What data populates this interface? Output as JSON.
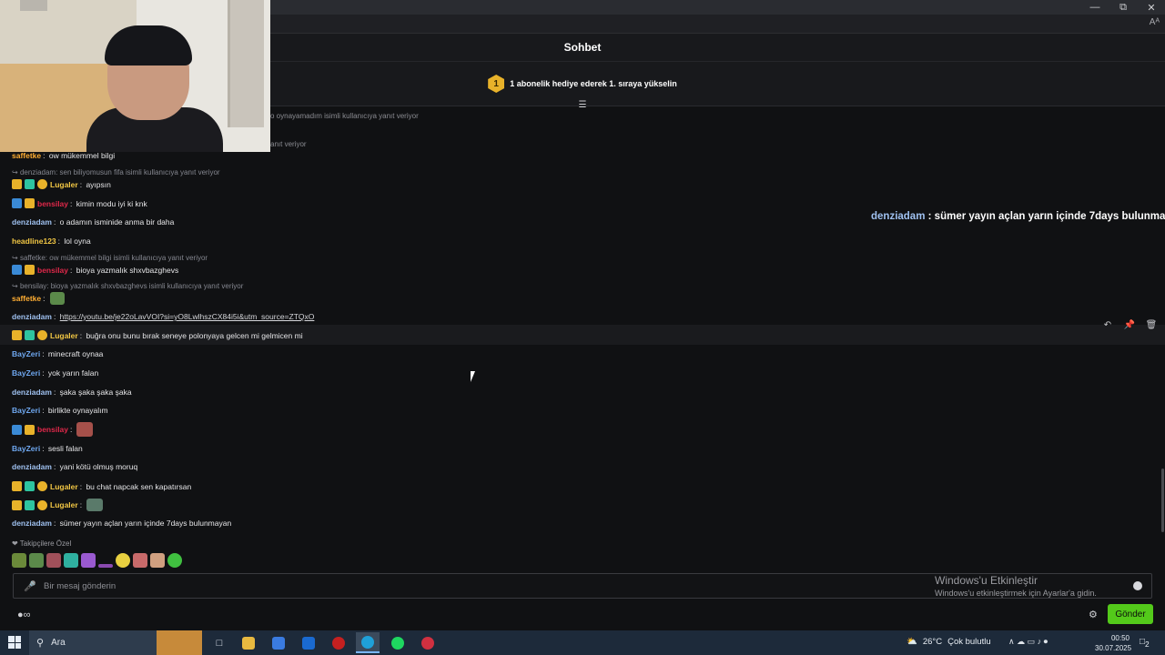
{
  "window": {
    "minimize": "—",
    "maximize": "⧉",
    "close": "✕",
    "reader_glyph": "Aᴬ"
  },
  "header": {
    "title": "Sohbet"
  },
  "pinned": {
    "rank": "1",
    "text": "1 abonelik hediye ederek 1. sıraya yükselin"
  },
  "system_lines": [
    "o oynayamadım isimli kullanıcıya yanıt veriyor",
    "anıt veriyor"
  ],
  "messages": [
    {
      "user": "saffetke",
      "text": "ow mükemmel bilgi"
    },
    {
      "reply": "denziadam: sen biliyomusun fifa isimli kullanıcıya yanıt veriyor"
    },
    {
      "user": "Lugaler",
      "text": "ayıpsın"
    },
    {
      "user": "bensilay",
      "text": "kimin modu iyi ki knk"
    },
    {
      "user": "denziadam",
      "text": "o adamın isminide anma bir daha"
    },
    {
      "user": "headline123",
      "text": "lol oyna"
    },
    {
      "reply": "saffetke: ow mükemmel bilgi isimli kullanıcıya yanıt veriyor"
    },
    {
      "user": "bensilay",
      "text": "bioya yazmalık shxvbazghevs"
    },
    {
      "reply": "bensilay: bioya yazmalık shxvbazghevs isimli kullanıcıya yanıt veriyor"
    },
    {
      "user": "saffetke",
      "text": ""
    },
    {
      "user": "denziadam",
      "text": "https://youtu.be/je22oLavVOI?si=yO8LwlhszCX84i5i&utm_source=ZTQxO"
    },
    {
      "user": "Lugaler",
      "text": "buğra onu bunu bırak seneye polonyaya gelcen mi gelmicen mi"
    },
    {
      "user": "BayZeri",
      "text": "minecraft oynaa"
    },
    {
      "user": "BayZeri",
      "text": "yok yarın falan"
    },
    {
      "user": "denziadam",
      "text": "şaka şaka şaka şaka"
    },
    {
      "user": "BayZeri",
      "text": "birlikte oynayalım"
    },
    {
      "user": "bensilay",
      "text": ""
    },
    {
      "user": "BayZeri",
      "text": "sesli falan"
    },
    {
      "user": "denziadam",
      "text": "yani kötü olmuş moruq"
    },
    {
      "user": "Lugaler",
      "text": "bu chat napcak sen kapatırsan"
    },
    {
      "user": "Lugaler",
      "text": ""
    },
    {
      "user": "denziadam",
      "text": "sümer yayın açlan yarın içinde 7days bulunmayan"
    }
  ],
  "overlay": {
    "user": "denziadam",
    "sep": " : ",
    "text": "sümer yayın açlan yarın içinde 7days bulunmayan"
  },
  "mod_tools": {
    "undo": "↶",
    "pin": "📌",
    "delete": "🗑"
  },
  "followers": {
    "label": "❤ Takipçilere Özel"
  },
  "composer": {
    "placeholder": "Bir mesaj gönderin",
    "send_label": "Gönder",
    "left_icons": "●∞",
    "settings": "⚙"
  },
  "activation": {
    "title": "Windows'u Etkinleştir",
    "subtitle": "Windows'u etkinleştirmek için Ayarlar'a gidin."
  },
  "taskbar": {
    "search_label": "Ara",
    "weather_temp": "26°C",
    "weather_desc": "Çok bulutlu",
    "time": "00:50",
    "date": "30.07.2025",
    "notif_count": "2",
    "tray": "∧ ☁ ▭ ♪ ⏺"
  },
  "colors": {
    "accent_green": "#53c91a",
    "crown_gold": "#e8b22a"
  }
}
